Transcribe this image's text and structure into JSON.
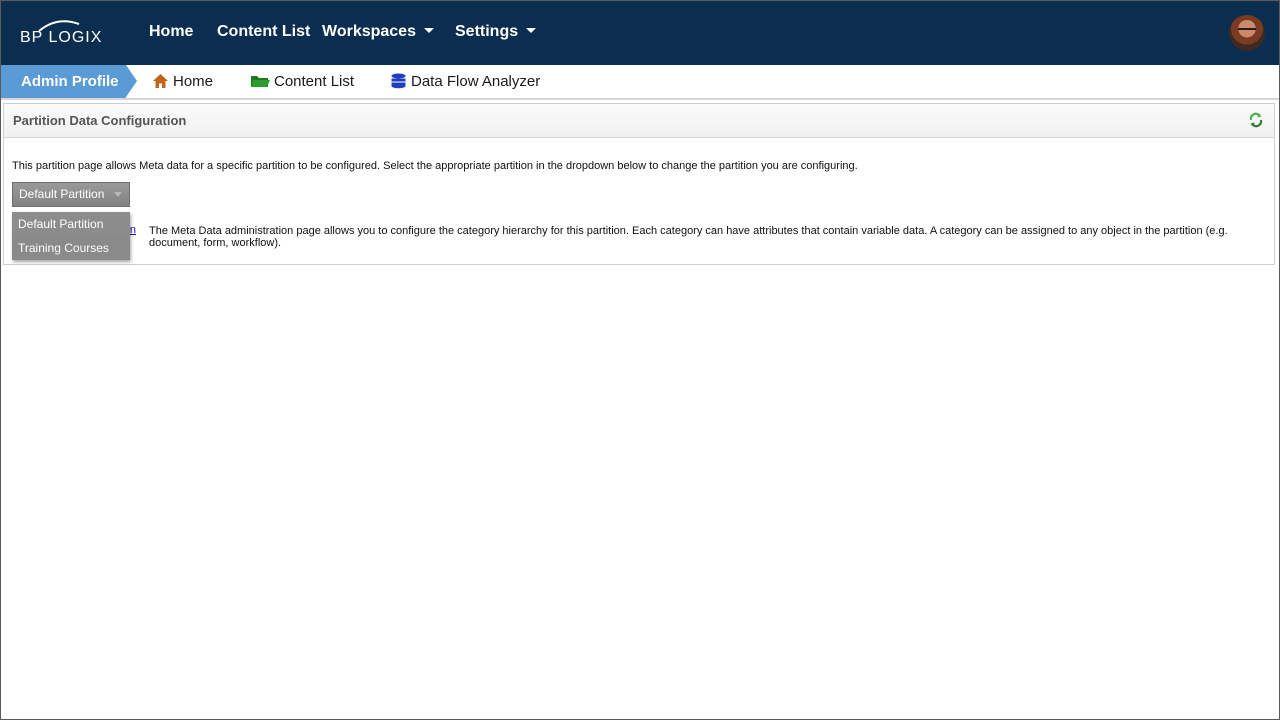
{
  "brand": {
    "logo_text": "BP LOGIX"
  },
  "topnav": {
    "items": [
      {
        "label": "Home"
      },
      {
        "label": "Content List"
      },
      {
        "label": "Workspaces"
      },
      {
        "label": "Settings"
      }
    ]
  },
  "tabbar": {
    "active": "Admin Profile",
    "crumbs": [
      {
        "label": "Home",
        "icon": "home-icon"
      },
      {
        "label": "Content List",
        "icon": "folder-icon"
      },
      {
        "label": "Data Flow Analyzer",
        "icon": "database-icon"
      }
    ]
  },
  "panel": {
    "title": "Partition Data Configuration",
    "description": "This partition page allows Meta data for a specific partition to be configured. Select the appropriate partition in the dropdown below to change the partition you are configuring.",
    "selected_partition": "Default Partition",
    "partition_options": [
      "Default Partition",
      "Training Courses"
    ],
    "meta_link_label": "Meta Data Administration",
    "meta_description": "The Meta Data administration page allows you to configure the category hierarchy for this partition. Each category can have attributes that contain variable data. A category can be assigned to any object in the partition (e.g. document, form, workflow)."
  },
  "colors": {
    "topbar": "#0b2d4f",
    "active_tab": "#5b9bd5",
    "home_icon": "#c0651a",
    "folder_icon": "#2e8b2e",
    "database_icon": "#1f3fbf",
    "refresh_icon": "#4caf50"
  }
}
